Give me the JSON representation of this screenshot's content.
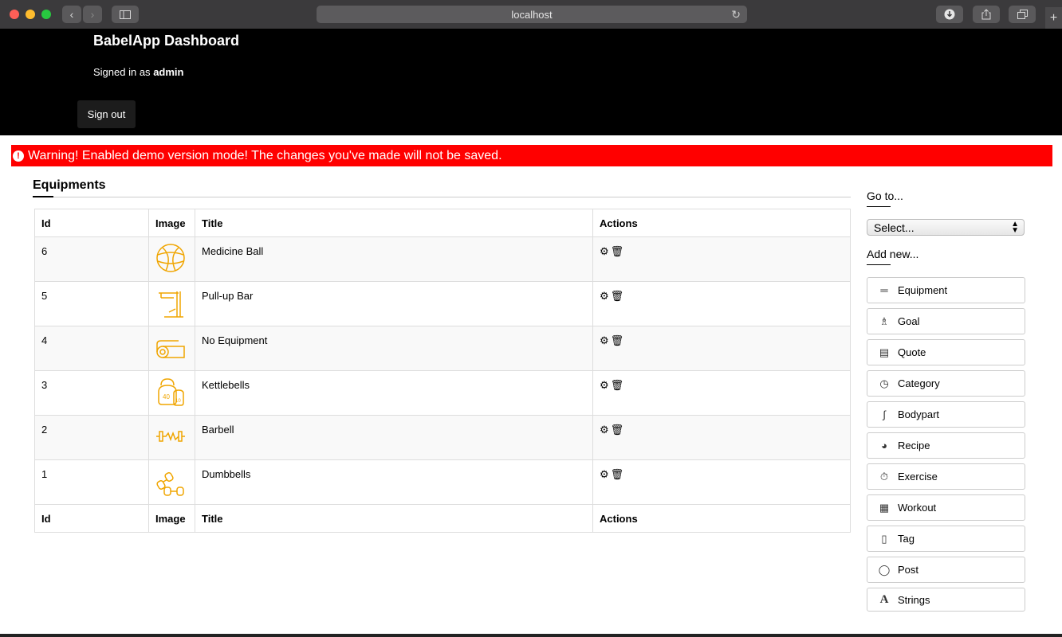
{
  "browser": {
    "url": "localhost"
  },
  "header": {
    "title": "BabelApp Dashboard",
    "signed_prefix": "Signed in as",
    "username": "admin",
    "signout_label": "Sign out"
  },
  "warning": {
    "text": "Warning! Enabled demo version mode! The changes you've made will not be saved.",
    "icon": "exclamation-circle-icon"
  },
  "main": {
    "title": "Equipments",
    "columns": [
      "Id",
      "Image",
      "Title",
      "Actions"
    ],
    "rows": [
      {
        "id": "6",
        "title": "Medicine Ball",
        "icon": "medicine-ball-icon"
      },
      {
        "id": "5",
        "title": "Pull-up Bar",
        "icon": "pull-up-bar-icon"
      },
      {
        "id": "4",
        "title": "No Equipment",
        "icon": "mat-icon"
      },
      {
        "id": "3",
        "title": "Kettlebells",
        "icon": "kettlebell-icon",
        "weights": [
          "40",
          "10"
        ]
      },
      {
        "id": "2",
        "title": "Barbell",
        "icon": "barbell-icon"
      },
      {
        "id": "1",
        "title": "Dumbbells",
        "icon": "dumbbell-icon"
      }
    ],
    "icon_color": "#f0a500"
  },
  "sidebar": {
    "goto_label": "Go to...",
    "select_value": "Select...",
    "addnew_label": "Add new...",
    "buttons": [
      {
        "label": "Equipment",
        "icon": "dumbbell-icon"
      },
      {
        "label": "Goal",
        "icon": "trophy-icon"
      },
      {
        "label": "Quote",
        "icon": "clipboard-icon"
      },
      {
        "label": "Category",
        "icon": "stopwatch-icon"
      },
      {
        "label": "Bodypart",
        "icon": "arm-icon"
      },
      {
        "label": "Recipe",
        "icon": "bowl-icon"
      },
      {
        "label": "Exercise",
        "icon": "timer-icon"
      },
      {
        "label": "Workout",
        "icon": "calendar-icon"
      },
      {
        "label": "Tag",
        "icon": "bottle-icon"
      },
      {
        "label": "Post",
        "icon": "watch-icon"
      },
      {
        "label": "Strings",
        "icon": "font-icon"
      }
    ]
  }
}
